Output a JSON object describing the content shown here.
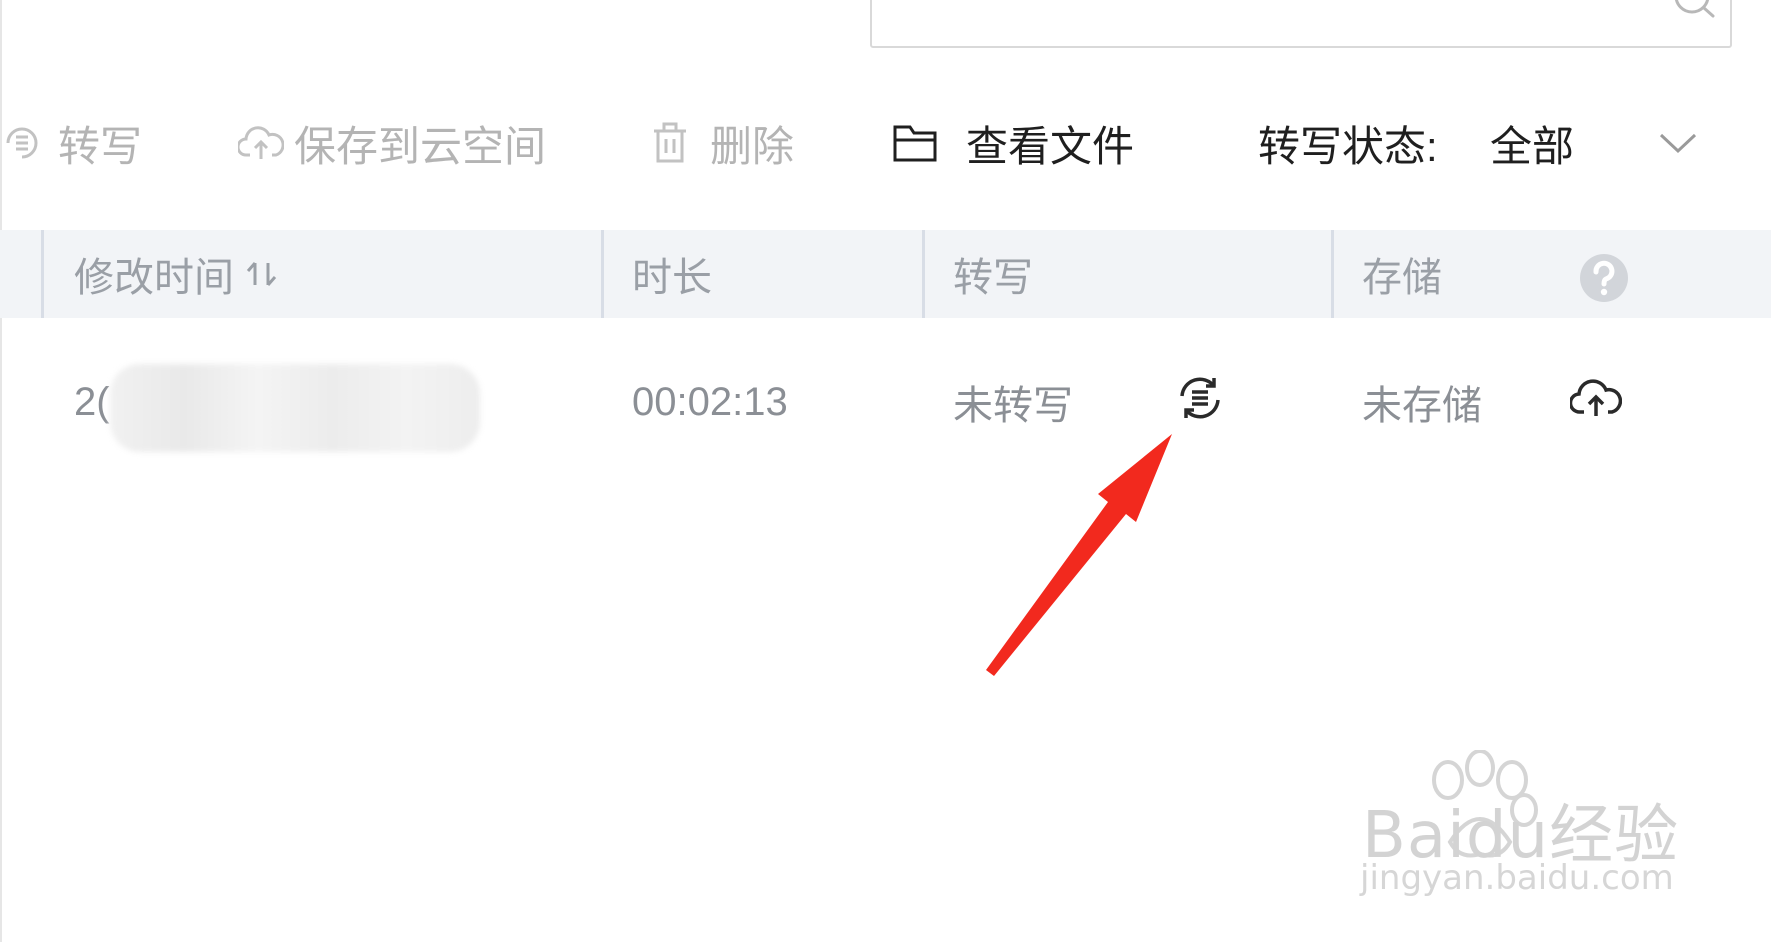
{
  "search": {
    "icon": "search-icon"
  },
  "toolbar": {
    "transcribe_label": "转写",
    "save_cloud_label": "保存到云空间",
    "delete_label": "删除",
    "view_files_label": "查看文件",
    "status_label": "转写状态:",
    "status_value": "全部"
  },
  "table": {
    "headers": {
      "modified_time": "修改时间",
      "duration": "时长",
      "transcription": "转写",
      "storage": "存储"
    },
    "rows": [
      {
        "modified_time_visible": "2(",
        "duration": "00:02:13",
        "transcription_status": "未转写",
        "storage_status": "未存储"
      }
    ]
  },
  "colors": {
    "accent_arrow": "#f2291e",
    "header_bg": "#f2f4f7",
    "disabled_text": "#b4b4b4"
  },
  "watermark": {
    "brand": "Bai",
    "brand_suffix": "du",
    "cn": "经验",
    "url": "jingyan.baidu.com"
  }
}
